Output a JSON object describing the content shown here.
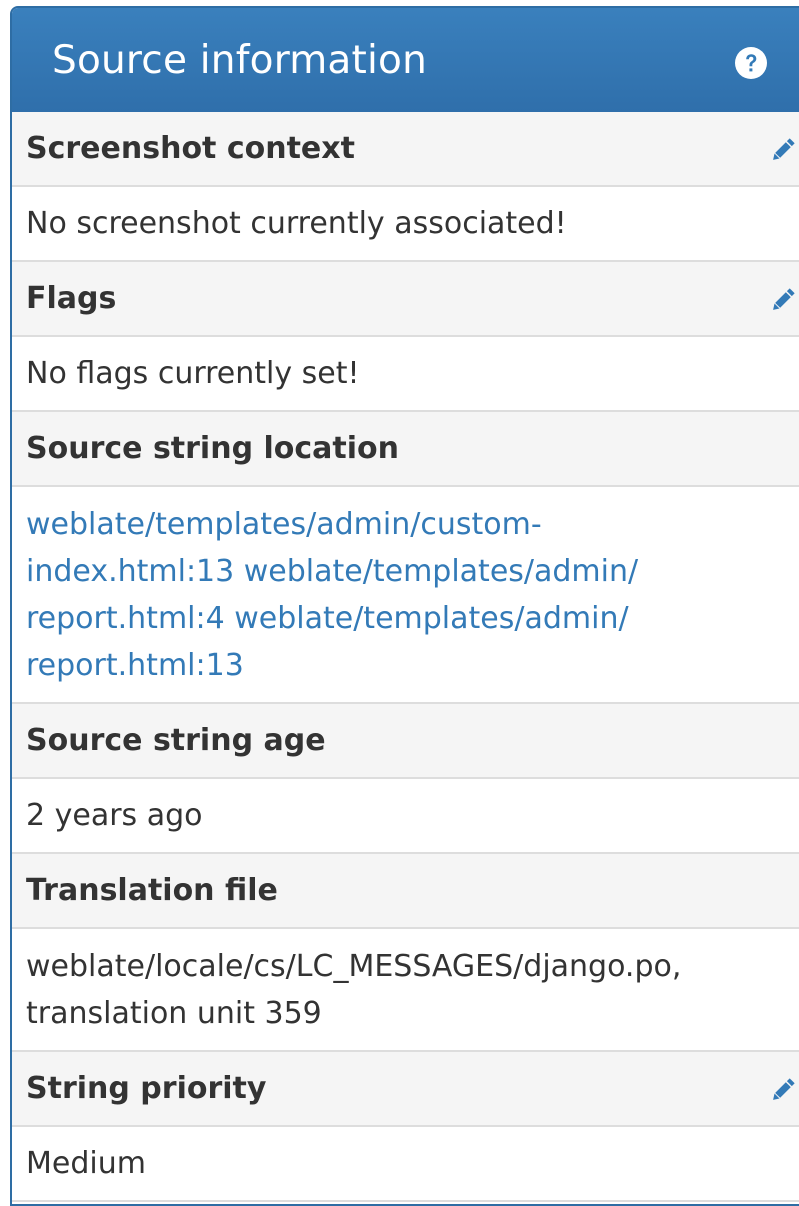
{
  "panel": {
    "title": "Source information",
    "help_icon": "question-circle-icon",
    "accent_color": "#337ab7"
  },
  "sections": {
    "screenshot_context": {
      "label": "Screenshot context",
      "value": "No screenshot currently associated!",
      "edit_icon": "pencil-icon"
    },
    "flags": {
      "label": "Flags",
      "value": "No flags currently set!",
      "edit_icon": "pencil-icon"
    },
    "source_string_location": {
      "label": "Source string location",
      "line1": "weblate/templates/admin/custom-",
      "line2": "index.html:13 weblate/templates/admin/",
      "line3": "report.html:4 weblate/templates/admin/",
      "line4": "report.html:13"
    },
    "source_string_age": {
      "label": "Source string age",
      "value": "2 years ago"
    },
    "translation_file": {
      "label": "Translation file",
      "line1": "weblate/locale/cs/LC_MESSAGES/django.po,",
      "line2": "translation unit 359"
    },
    "string_priority": {
      "label": "String priority",
      "value": "Medium",
      "edit_icon": "pencil-icon"
    }
  }
}
